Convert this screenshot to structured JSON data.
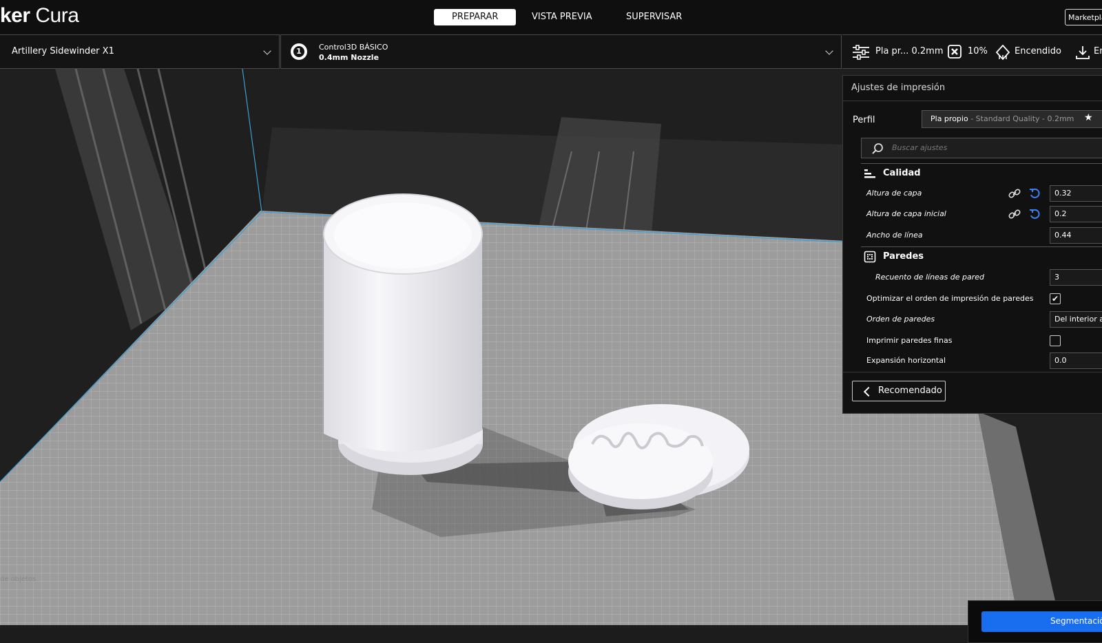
{
  "app": {
    "logo_bold": "ker",
    "logo_light": " Cura"
  },
  "nav": {
    "prepare": "PREPARAR",
    "preview": "VISTA PREVIA",
    "monitor": "SUPERVISAR",
    "marketplace": "Marketplace"
  },
  "printer": {
    "name": "Artillery Sidewinder X1"
  },
  "material": {
    "extruder_number": "1",
    "line1": "Control3D BÁSICO",
    "line2": "0.4mm Nozzle"
  },
  "summary": {
    "profile": "Pla pr... 0.2mm",
    "infill": "10%",
    "support": "Encendido",
    "adhesion": "En"
  },
  "panel": {
    "title": "Ajustes de impresión",
    "profile_label": "Perfil",
    "profile_name": "Pla propio",
    "profile_sub": " - Standard Quality - 0.2mm",
    "search_placeholder": "Buscar ajustes",
    "quality": {
      "title": "Calidad",
      "layer_height": {
        "label": "Altura de capa",
        "value": "0.32"
      },
      "initial_layer_height": {
        "label": "Altura de capa inicial",
        "value": "0.2"
      },
      "line_width": {
        "label": "Ancho de línea",
        "value": "0.44"
      }
    },
    "walls": {
      "title": "Paredes",
      "wall_line_count": {
        "label": "Recuento de líneas de pared",
        "value": "3"
      },
      "optimize_order": {
        "label": "Optimizar el orden de impresión de paredes",
        "checked": true
      },
      "wall_order": {
        "label": "Orden de paredes",
        "value": "Del interior al exterior"
      },
      "thin_walls": {
        "label": "Imprimir paredes finas",
        "checked": false
      },
      "horizontal_expansion": {
        "label": "Expansión horizontal",
        "value": "0.0"
      }
    },
    "recommended_button": "Recomendado"
  },
  "viewport": {
    "object_list": "de objetos",
    "slice_button": "Segmentación"
  },
  "colors": {
    "accent": "#196ef0",
    "topbar": "#0f0f0f",
    "panel": "#111111",
    "buildplate": "#9a9a9a",
    "model": "#f2f2f6"
  }
}
